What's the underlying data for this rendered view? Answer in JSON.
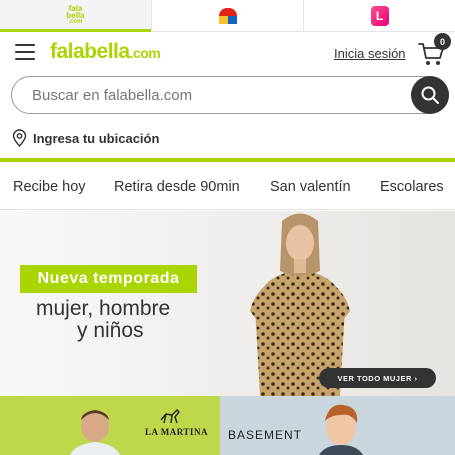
{
  "brand_tabs": [
    {
      "name": "falabella",
      "label_lines": [
        "fala",
        "bella",
        ".com"
      ]
    },
    {
      "name": "sodimac",
      "label": ""
    },
    {
      "name": "linio",
      "label": "L"
    }
  ],
  "header": {
    "logo_text": "falabella",
    "logo_suffix": ".com",
    "login_label": "Inicia sesión",
    "cart_count": "0"
  },
  "search": {
    "placeholder": "Buscar en falabella.com"
  },
  "location": {
    "label": "Ingresa tu ubicación"
  },
  "categories": [
    {
      "label": "Recibe hoy"
    },
    {
      "label": "Retira desde 90min"
    },
    {
      "label": "San valentín"
    },
    {
      "label": "Escolares"
    }
  ],
  "banner": {
    "badge": "Nueva temporada",
    "line1": "mujer, hombre",
    "line2": "y niños",
    "cta": "VER TODO MUJER  ›"
  },
  "promos": {
    "left_brand": "LA MARTINA",
    "right_brand": "BASEMENT"
  },
  "colors": {
    "accent": "#aad500",
    "dark": "#333333"
  }
}
